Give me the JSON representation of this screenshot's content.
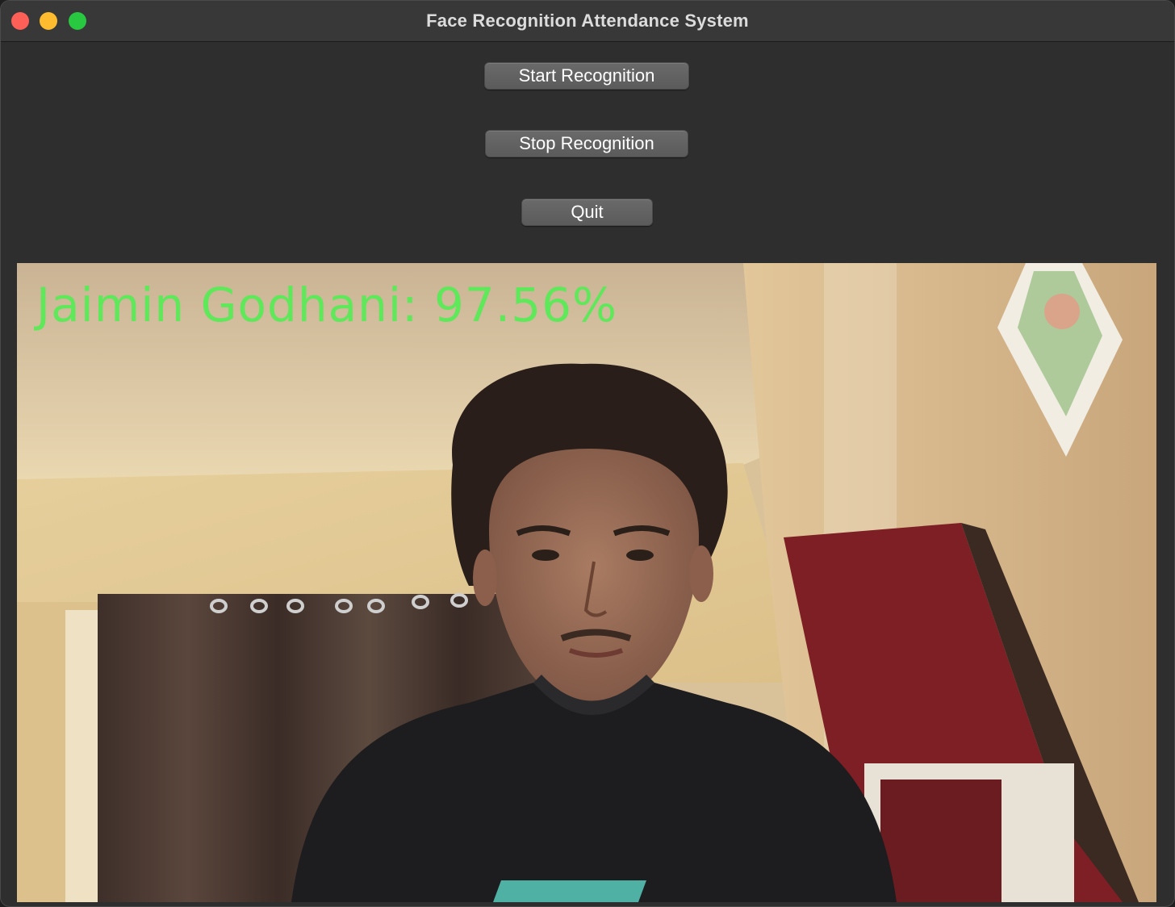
{
  "window": {
    "title": "Face Recognition Attendance System"
  },
  "controls": {
    "start_label": "Start Recognition",
    "stop_label": "Stop Recognition",
    "quit_label": "Quit"
  },
  "camera": {
    "recognition_label": "Jaimin  Godhani: 97.56%",
    "label_color": "#5ee85a"
  },
  "colors": {
    "close": "#fe5f57",
    "minimize": "#febc2e",
    "maximize": "#28c840"
  }
}
